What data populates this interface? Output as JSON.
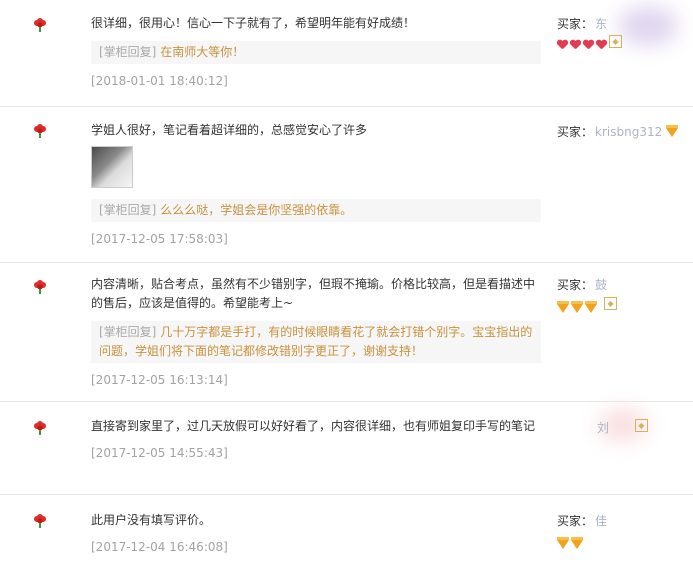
{
  "reviews": [
    {
      "text": "很详细，很用心！信心一下子就有了，希望明年能有好成绩！",
      "reply_tag": "[掌柜回复]",
      "reply": "在南师大等你！",
      "time": "[2018-01-01 18:40:12]",
      "buyer_label": "买家：",
      "buyer_name": "东"
    },
    {
      "text": "学姐人很好，笔记看着超详细的，总感觉安心了许多",
      "reply_tag": "[掌柜回复]",
      "reply": "么么么哒，学姐会是你坚强的依靠。",
      "time": "[2017-12-05 17:58:03]",
      "buyer_label": "买家：",
      "buyer_name": "krisbng312"
    },
    {
      "text": "内容清晰，贴合考点，虽然有不少错别字，但瑕不掩瑜。价格比较高，但是看描述中的售后，应该是值得的。希望能考上~",
      "reply_tag": "[掌柜回复]",
      "reply": "几十万字都是手打，有的时候眼睛看花了就会打错个别字。宝宝指出的问题，学姐们将下面的笔记都修改错别字更正了，谢谢支持！",
      "time": "[2017-12-05 16:13:14]",
      "buyer_label": "买家：",
      "buyer_name": "鼓"
    },
    {
      "text": "直接寄到家里了，过几天放假可以好好看了，内容很详细，也有师姐复印手写的笔记",
      "time": "[2017-12-05 14:55:43]",
      "buyer_label": "",
      "buyer_name": "刘"
    },
    {
      "text": "此用户没有填写评价。",
      "time": "[2017-12-04 16:46:08]",
      "buyer_label": "买家：",
      "buyer_name": "佳"
    }
  ],
  "colors": {
    "reply": "#c7923f",
    "time": "#a3a3a3",
    "heart": "#e23b52",
    "diamond": "#f0a41e"
  },
  "icons": [
    "flower-icon",
    "heart-icon",
    "diamond-icon",
    "tmall-badge-icon"
  ]
}
